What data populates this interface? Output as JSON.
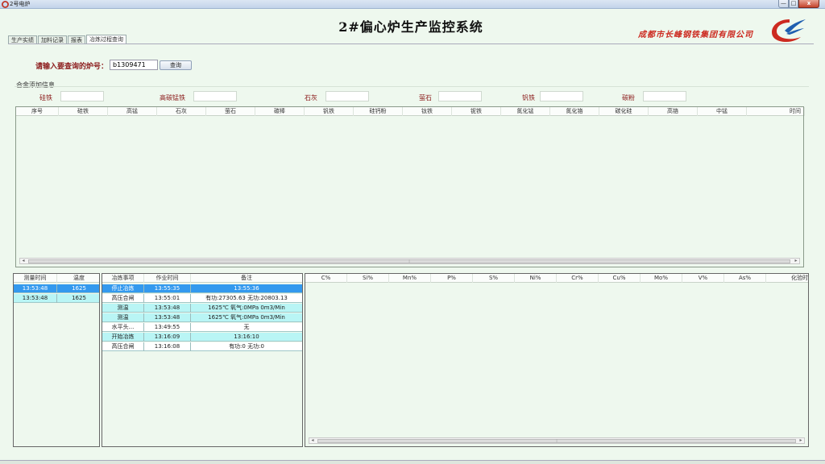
{
  "window": {
    "title": "2号电炉",
    "min_label": "—",
    "max_label": "□",
    "close_label": "x"
  },
  "header": {
    "title": "2#偏心炉生产监控系统",
    "company": "成都市长峰钢铁集团有限公司"
  },
  "tabs": [
    {
      "label": "生产实绩"
    },
    {
      "label": "加料记录"
    },
    {
      "label": "报表"
    },
    {
      "label": "冶炼过程查询",
      "active": true
    }
  ],
  "query": {
    "label": "请输入要查询的炉号：",
    "value": "b1309471",
    "button": "查询"
  },
  "alloy": {
    "title": "合金添加信息",
    "fields": [
      {
        "label": "硅铁",
        "value": ""
      },
      {
        "label": "高碳锰铁",
        "value": ""
      },
      {
        "label": "石灰",
        "value": ""
      },
      {
        "label": "萤石",
        "value": ""
      },
      {
        "label": "钒铁",
        "value": ""
      },
      {
        "label": "碳粉",
        "value": ""
      }
    ]
  },
  "grid1": {
    "columns": [
      "序号",
      "硅铁",
      "高锰",
      "石灰",
      "萤石",
      "碳棒",
      "钒铁",
      "硅钙粉",
      "钛铁",
      "铌铁",
      "氮化锰",
      "氮化铬",
      "碳化硅",
      "高铬",
      "中锰",
      "时间"
    ],
    "scroll_marker": "⁞"
  },
  "grid2": {
    "columns": [
      "测量时间",
      "温度"
    ],
    "rows": [
      {
        "time": "13:53:48",
        "temp": "1625",
        "style": "sel"
      },
      {
        "time": "13:53:48",
        "temp": "1625",
        "style": "cyan"
      }
    ]
  },
  "grid3": {
    "columns": [
      "冶炼事项",
      "作业时间",
      "备注"
    ],
    "rows": [
      {
        "event": "停止冶炼",
        "time": "13:55:35",
        "note": "13:55:36",
        "style": "sel"
      },
      {
        "event": "高压合闸",
        "time": "13:55:01",
        "note": "有功:27305.63 无功:20803.13",
        "style": "white"
      },
      {
        "event": "测温",
        "time": "13:53:48",
        "note": "1625℃ 氧气:0MPa 0m3/Min",
        "style": "cyan"
      },
      {
        "event": "测温",
        "time": "13:53:48",
        "note": "1625℃ 氧气:0MPa 0m3/Min",
        "style": "cyan"
      },
      {
        "event": "水平头...",
        "time": "13:49:55",
        "note": "无",
        "style": "white"
      },
      {
        "event": "开始冶炼",
        "time": "13:16:09",
        "note": "13:16:10",
        "style": "cyan"
      },
      {
        "event": "高压合闸",
        "time": "13:16:08",
        "note": "有功:0 无功:0",
        "style": "white"
      }
    ]
  },
  "grid4": {
    "columns": [
      "C%",
      "Si%",
      "Mn%",
      "P%",
      "S%",
      "Ni%",
      "Cr%",
      "Cu%",
      "Mo%",
      "V%",
      "As%",
      "化验时"
    ],
    "scroll_marker": "⁞"
  },
  "colors": {
    "accent_red": "#8b1a1a",
    "selected": "#3399ee",
    "alt_row": "#b9f5f5",
    "background": "#eef8ee"
  }
}
